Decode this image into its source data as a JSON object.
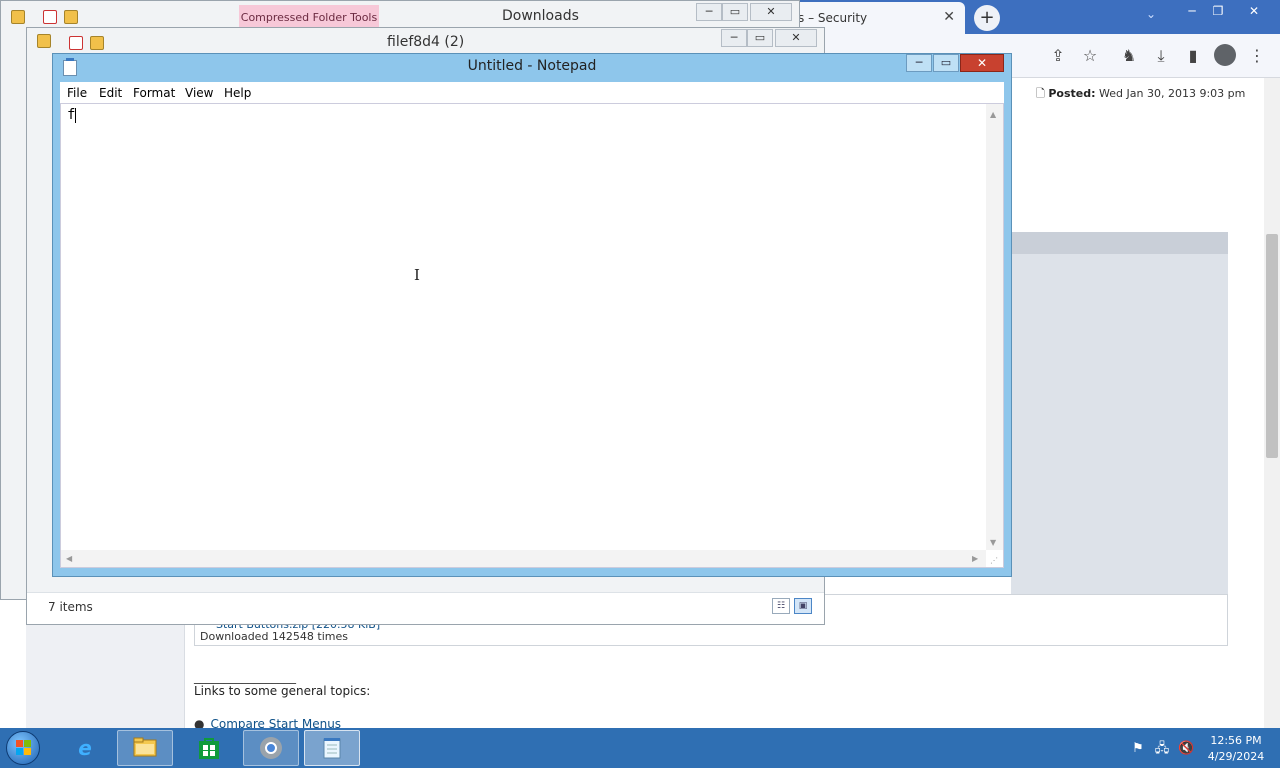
{
  "browser": {
    "tab_title": "s – Security",
    "tab_close_glyph": "✕",
    "new_tab_glyph": "+",
    "tab_search_glyph": "⌄",
    "toolbar_icons": [
      "share-icon",
      "star-icon",
      "extensions-icon",
      "download-icon",
      "sidebar-icon",
      "profile-icon",
      "kebab-menu-icon"
    ],
    "post": {
      "posted_label": "Posted:",
      "posted_date": "Wed Jan 30, 2013 9:03 pm",
      "download_name": "Start Buttons.zip [220.58 KiB]",
      "download_count": "Downloaded 142548 times",
      "signature_line": "_________________",
      "links_heading": "Links to some general topics:",
      "link_item": "Compare Start Menus"
    }
  },
  "explorer_downloads": {
    "title": "Downloads",
    "ribbon_tab": "Compressed Folder Tools"
  },
  "explorer_file": {
    "title": "filef8d4 (2)",
    "status": "7 items",
    "views": [
      "details-view-icon",
      "large-icons-view-icon"
    ]
  },
  "notepad": {
    "title": "Untitled - Notepad",
    "menus": [
      "File",
      "Edit",
      "Format",
      "View",
      "Help"
    ],
    "content": "f",
    "close_glyph": "✕",
    "minimize_glyph": "─",
    "maximize_glyph": "▭"
  },
  "taskbar": {
    "apps": [
      "internet-explorer-icon",
      "file-explorer-icon",
      "store-icon",
      "chrome-icon",
      "notepad-icon"
    ],
    "time": "12:56 PM",
    "date": "4/29/2024"
  },
  "colors": {
    "taskbar": "#2f6fb3",
    "notepad_frame": "#8ec6eb",
    "close_button": "#c8412f",
    "compressed_tools_tab": "#f7c8d8"
  }
}
